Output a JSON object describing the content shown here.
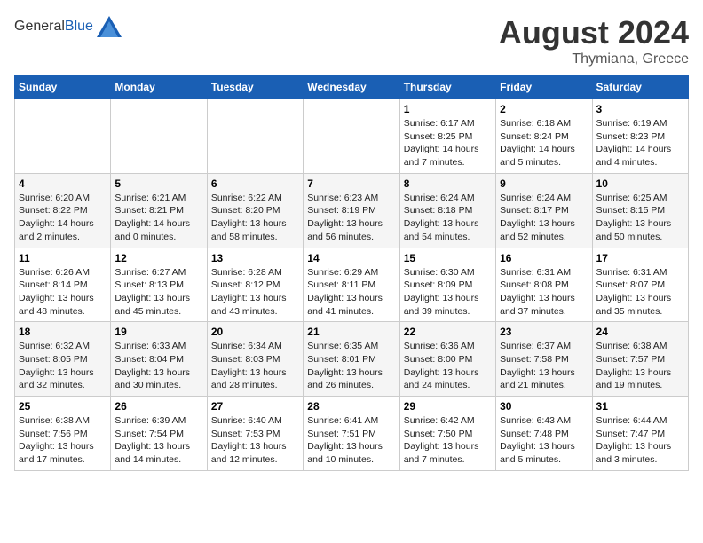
{
  "header": {
    "logo_general": "General",
    "logo_blue": "Blue",
    "month_year": "August 2024",
    "location": "Thymiana, Greece"
  },
  "weekdays": [
    "Sunday",
    "Monday",
    "Tuesday",
    "Wednesday",
    "Thursday",
    "Friday",
    "Saturday"
  ],
  "weeks": [
    [
      {
        "day": "",
        "info": ""
      },
      {
        "day": "",
        "info": ""
      },
      {
        "day": "",
        "info": ""
      },
      {
        "day": "",
        "info": ""
      },
      {
        "day": "1",
        "info": "Sunrise: 6:17 AM\nSunset: 8:25 PM\nDaylight: 14 hours\nand 7 minutes."
      },
      {
        "day": "2",
        "info": "Sunrise: 6:18 AM\nSunset: 8:24 PM\nDaylight: 14 hours\nand 5 minutes."
      },
      {
        "day": "3",
        "info": "Sunrise: 6:19 AM\nSunset: 8:23 PM\nDaylight: 14 hours\nand 4 minutes."
      }
    ],
    [
      {
        "day": "4",
        "info": "Sunrise: 6:20 AM\nSunset: 8:22 PM\nDaylight: 14 hours\nand 2 minutes."
      },
      {
        "day": "5",
        "info": "Sunrise: 6:21 AM\nSunset: 8:21 PM\nDaylight: 14 hours\nand 0 minutes."
      },
      {
        "day": "6",
        "info": "Sunrise: 6:22 AM\nSunset: 8:20 PM\nDaylight: 13 hours\nand 58 minutes."
      },
      {
        "day": "7",
        "info": "Sunrise: 6:23 AM\nSunset: 8:19 PM\nDaylight: 13 hours\nand 56 minutes."
      },
      {
        "day": "8",
        "info": "Sunrise: 6:24 AM\nSunset: 8:18 PM\nDaylight: 13 hours\nand 54 minutes."
      },
      {
        "day": "9",
        "info": "Sunrise: 6:24 AM\nSunset: 8:17 PM\nDaylight: 13 hours\nand 52 minutes."
      },
      {
        "day": "10",
        "info": "Sunrise: 6:25 AM\nSunset: 8:15 PM\nDaylight: 13 hours\nand 50 minutes."
      }
    ],
    [
      {
        "day": "11",
        "info": "Sunrise: 6:26 AM\nSunset: 8:14 PM\nDaylight: 13 hours\nand 48 minutes."
      },
      {
        "day": "12",
        "info": "Sunrise: 6:27 AM\nSunset: 8:13 PM\nDaylight: 13 hours\nand 45 minutes."
      },
      {
        "day": "13",
        "info": "Sunrise: 6:28 AM\nSunset: 8:12 PM\nDaylight: 13 hours\nand 43 minutes."
      },
      {
        "day": "14",
        "info": "Sunrise: 6:29 AM\nSunset: 8:11 PM\nDaylight: 13 hours\nand 41 minutes."
      },
      {
        "day": "15",
        "info": "Sunrise: 6:30 AM\nSunset: 8:09 PM\nDaylight: 13 hours\nand 39 minutes."
      },
      {
        "day": "16",
        "info": "Sunrise: 6:31 AM\nSunset: 8:08 PM\nDaylight: 13 hours\nand 37 minutes."
      },
      {
        "day": "17",
        "info": "Sunrise: 6:31 AM\nSunset: 8:07 PM\nDaylight: 13 hours\nand 35 minutes."
      }
    ],
    [
      {
        "day": "18",
        "info": "Sunrise: 6:32 AM\nSunset: 8:05 PM\nDaylight: 13 hours\nand 32 minutes."
      },
      {
        "day": "19",
        "info": "Sunrise: 6:33 AM\nSunset: 8:04 PM\nDaylight: 13 hours\nand 30 minutes."
      },
      {
        "day": "20",
        "info": "Sunrise: 6:34 AM\nSunset: 8:03 PM\nDaylight: 13 hours\nand 28 minutes."
      },
      {
        "day": "21",
        "info": "Sunrise: 6:35 AM\nSunset: 8:01 PM\nDaylight: 13 hours\nand 26 minutes."
      },
      {
        "day": "22",
        "info": "Sunrise: 6:36 AM\nSunset: 8:00 PM\nDaylight: 13 hours\nand 24 minutes."
      },
      {
        "day": "23",
        "info": "Sunrise: 6:37 AM\nSunset: 7:58 PM\nDaylight: 13 hours\nand 21 minutes."
      },
      {
        "day": "24",
        "info": "Sunrise: 6:38 AM\nSunset: 7:57 PM\nDaylight: 13 hours\nand 19 minutes."
      }
    ],
    [
      {
        "day": "25",
        "info": "Sunrise: 6:38 AM\nSunset: 7:56 PM\nDaylight: 13 hours\nand 17 minutes."
      },
      {
        "day": "26",
        "info": "Sunrise: 6:39 AM\nSunset: 7:54 PM\nDaylight: 13 hours\nand 14 minutes."
      },
      {
        "day": "27",
        "info": "Sunrise: 6:40 AM\nSunset: 7:53 PM\nDaylight: 13 hours\nand 12 minutes."
      },
      {
        "day": "28",
        "info": "Sunrise: 6:41 AM\nSunset: 7:51 PM\nDaylight: 13 hours\nand 10 minutes."
      },
      {
        "day": "29",
        "info": "Sunrise: 6:42 AM\nSunset: 7:50 PM\nDaylight: 13 hours\nand 7 minutes."
      },
      {
        "day": "30",
        "info": "Sunrise: 6:43 AM\nSunset: 7:48 PM\nDaylight: 13 hours\nand 5 minutes."
      },
      {
        "day": "31",
        "info": "Sunrise: 6:44 AM\nSunset: 7:47 PM\nDaylight: 13 hours\nand 3 minutes."
      }
    ]
  ]
}
